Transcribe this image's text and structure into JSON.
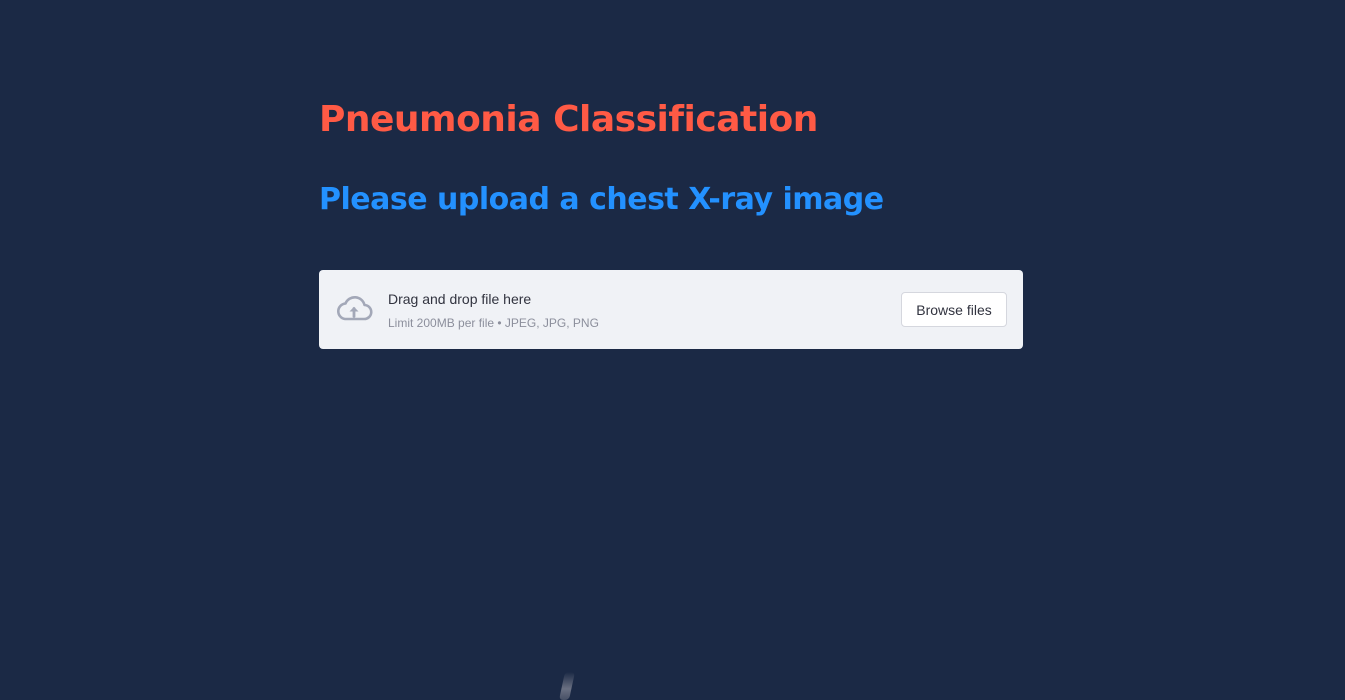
{
  "app": {
    "title": "Pneumonia Classification",
    "subtitle": "Please upload a chest X-ray image"
  },
  "uploader": {
    "icon": "cloud-upload-icon",
    "drag_text": "Drag and drop file here",
    "limit_text": "Limit 200MB per file • JPEG, JPG, PNG",
    "browse_label": "Browse files"
  },
  "colors": {
    "background": "#1b2945",
    "title": "#ff5a45",
    "subtitle": "#2391ff",
    "uploader_bg": "#f0f2f6"
  }
}
